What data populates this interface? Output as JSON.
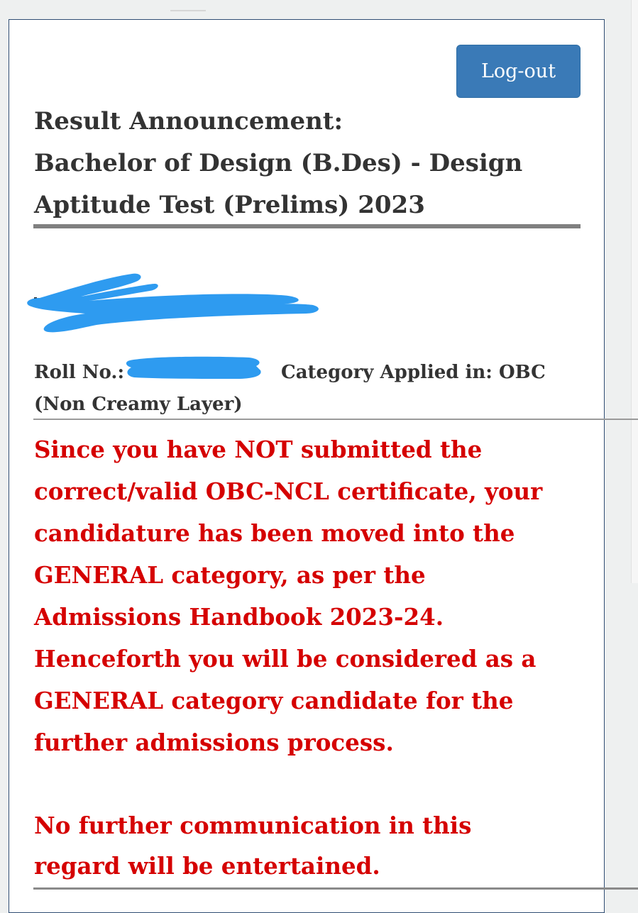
{
  "header": {
    "logout_label": "Log-out"
  },
  "result": {
    "title_lines": [
      "Result Announcement:",
      "Bachelor of Design (B.Des) - Design",
      "Aptitude Test (Prelims) 2023"
    ]
  },
  "candidate": {
    "roll_label": "Roll No.:",
    "category_label": "Category Applied in: OBC",
    "category_continued": "(Non Creamy Layer)"
  },
  "notice": {
    "lines": [
      "Since you have NOT submitted the",
      "correct/valid OBC-NCL certificate, your",
      "candidature has been moved into the",
      "GENERAL category, as per the",
      "Admissions Handbook 2023-24.",
      "Henceforth you will be considered as a",
      "GENERAL category candidate for the",
      "further admissions process."
    ],
    "closing_lines": [
      "No further communication in this",
      "regard will be entertained."
    ]
  },
  "colors": {
    "button": "#3a7ab7",
    "notice_text": "#d50000",
    "redaction": "#2e9bf0",
    "card_border": "#2f4d73"
  }
}
